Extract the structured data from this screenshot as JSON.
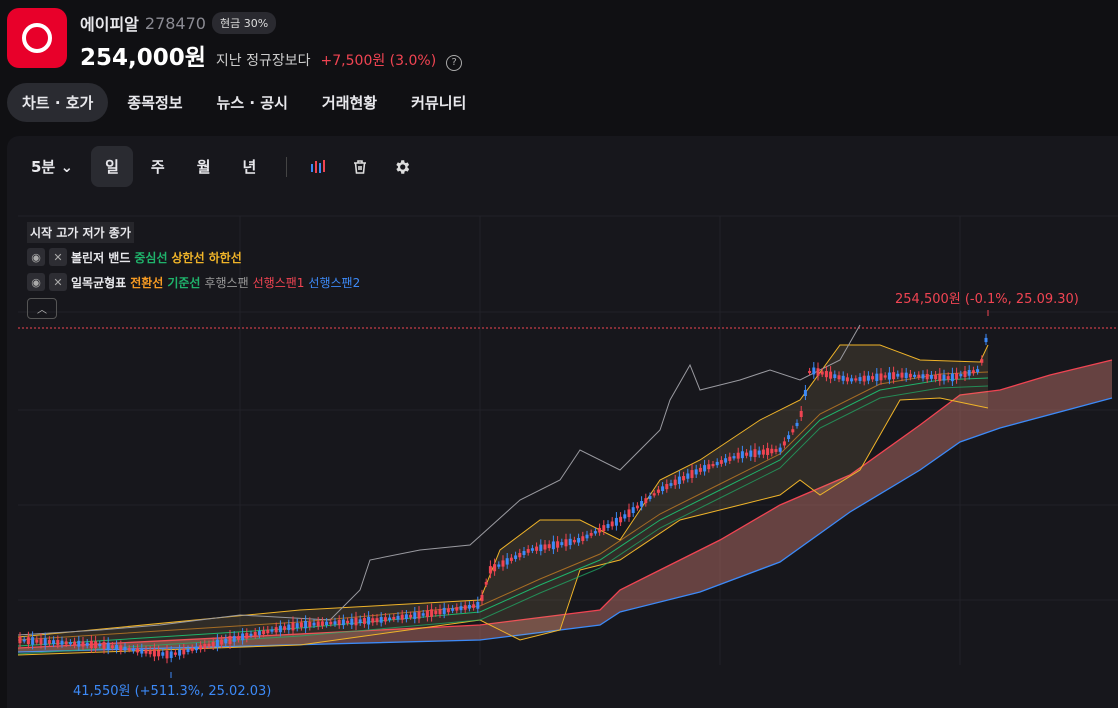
{
  "stock": {
    "name": "에이피알",
    "code": "278470",
    "badge": "현금 30%",
    "price": "254,000원",
    "compare_label": "지난 정규장보다",
    "change": "+7,500원 (3.0%)",
    "help": "?"
  },
  "tabs": [
    {
      "label": "차트 · 호가"
    },
    {
      "label": "종목정보"
    },
    {
      "label": "뉴스 · 공시"
    },
    {
      "label": "거래현황"
    },
    {
      "label": "커뮤니티"
    }
  ],
  "toolbar": {
    "interval": "5분",
    "periods": [
      "일",
      "주",
      "월",
      "년"
    ]
  },
  "legend": {
    "ohlc": "시작 고가 저가 종가",
    "bollinger": {
      "title": "볼린저 밴드",
      "items": [
        "중심선",
        "상한선",
        "하한선"
      ]
    },
    "ichimoku": {
      "title": "일목균형표",
      "items": [
        "전환선",
        "기준선",
        "후행스팬",
        "선행스팬1",
        "선행스팬2"
      ]
    }
  },
  "annotations": {
    "high": "254,500원 (-0.1%, 25.09.30)",
    "low": "41,550원 (+511.3%, 25.02.03)"
  },
  "colors": {
    "up": "#f04452",
    "down": "#3d8af7",
    "accent": "#e8002a"
  }
}
